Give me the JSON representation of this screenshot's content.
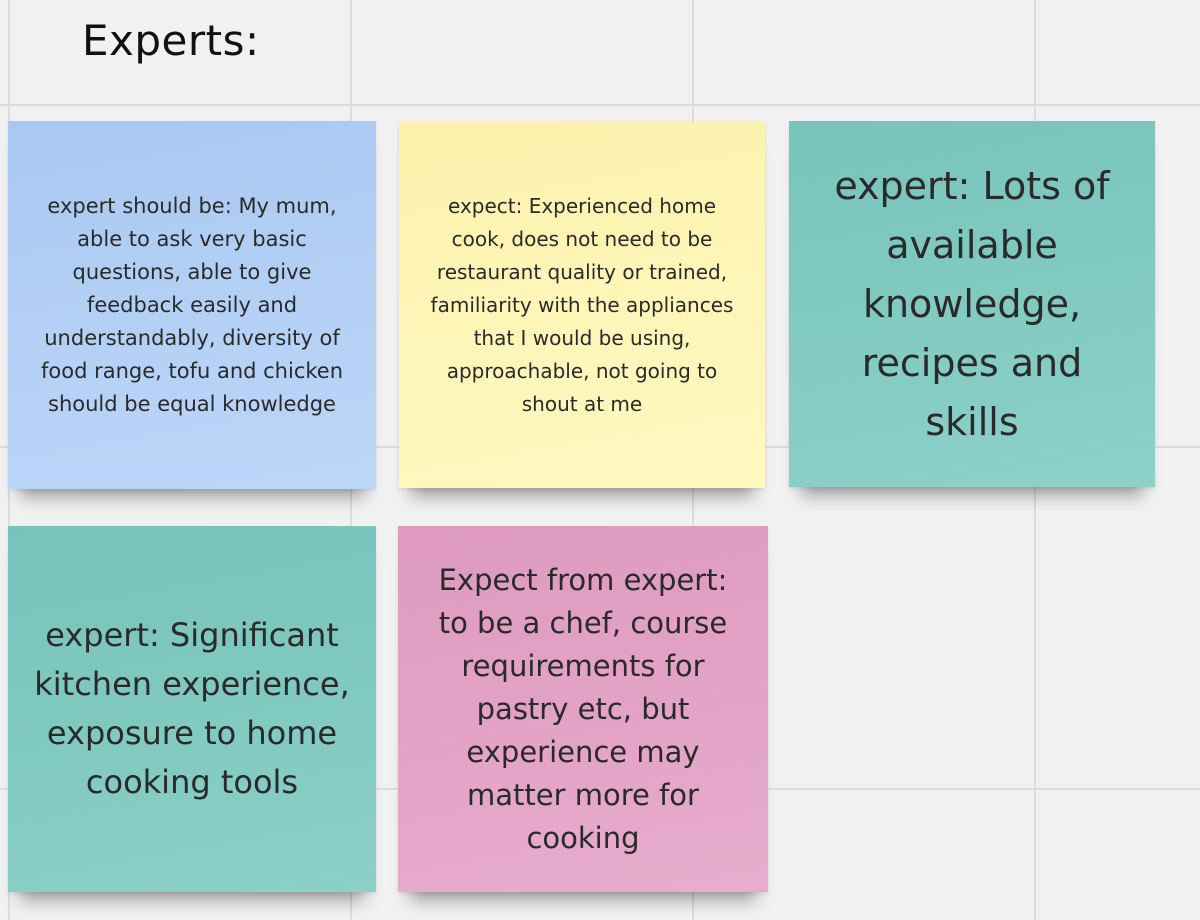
{
  "frame": {
    "title": "Experts:"
  },
  "notes": [
    {
      "color": "#b5d1f6",
      "text": "expert should be: My mum, able to ask very basic questions, able to give feedback easily and understandably, diversity of food range, tofu and chicken should be equal knowledge"
    },
    {
      "color": "#fef6b9",
      "text": "expect: Experienced home cook, does not need to be restaurant quality or trained, familiarity with the appliances that I would be using, approachable, not going to shout at me"
    },
    {
      "color": "#83cbc3",
      "text": "expert: Lots of available knowledge, recipes and skills"
    },
    {
      "color": "#82cac2",
      "text": "expert: Significant kitchen experience, exposure to home cooking tools"
    },
    {
      "color": "#e3a4c7",
      "text": "Expect from expert: to be a chef, course requirements for pastry etc, but experience may matter more for cooking"
    }
  ]
}
